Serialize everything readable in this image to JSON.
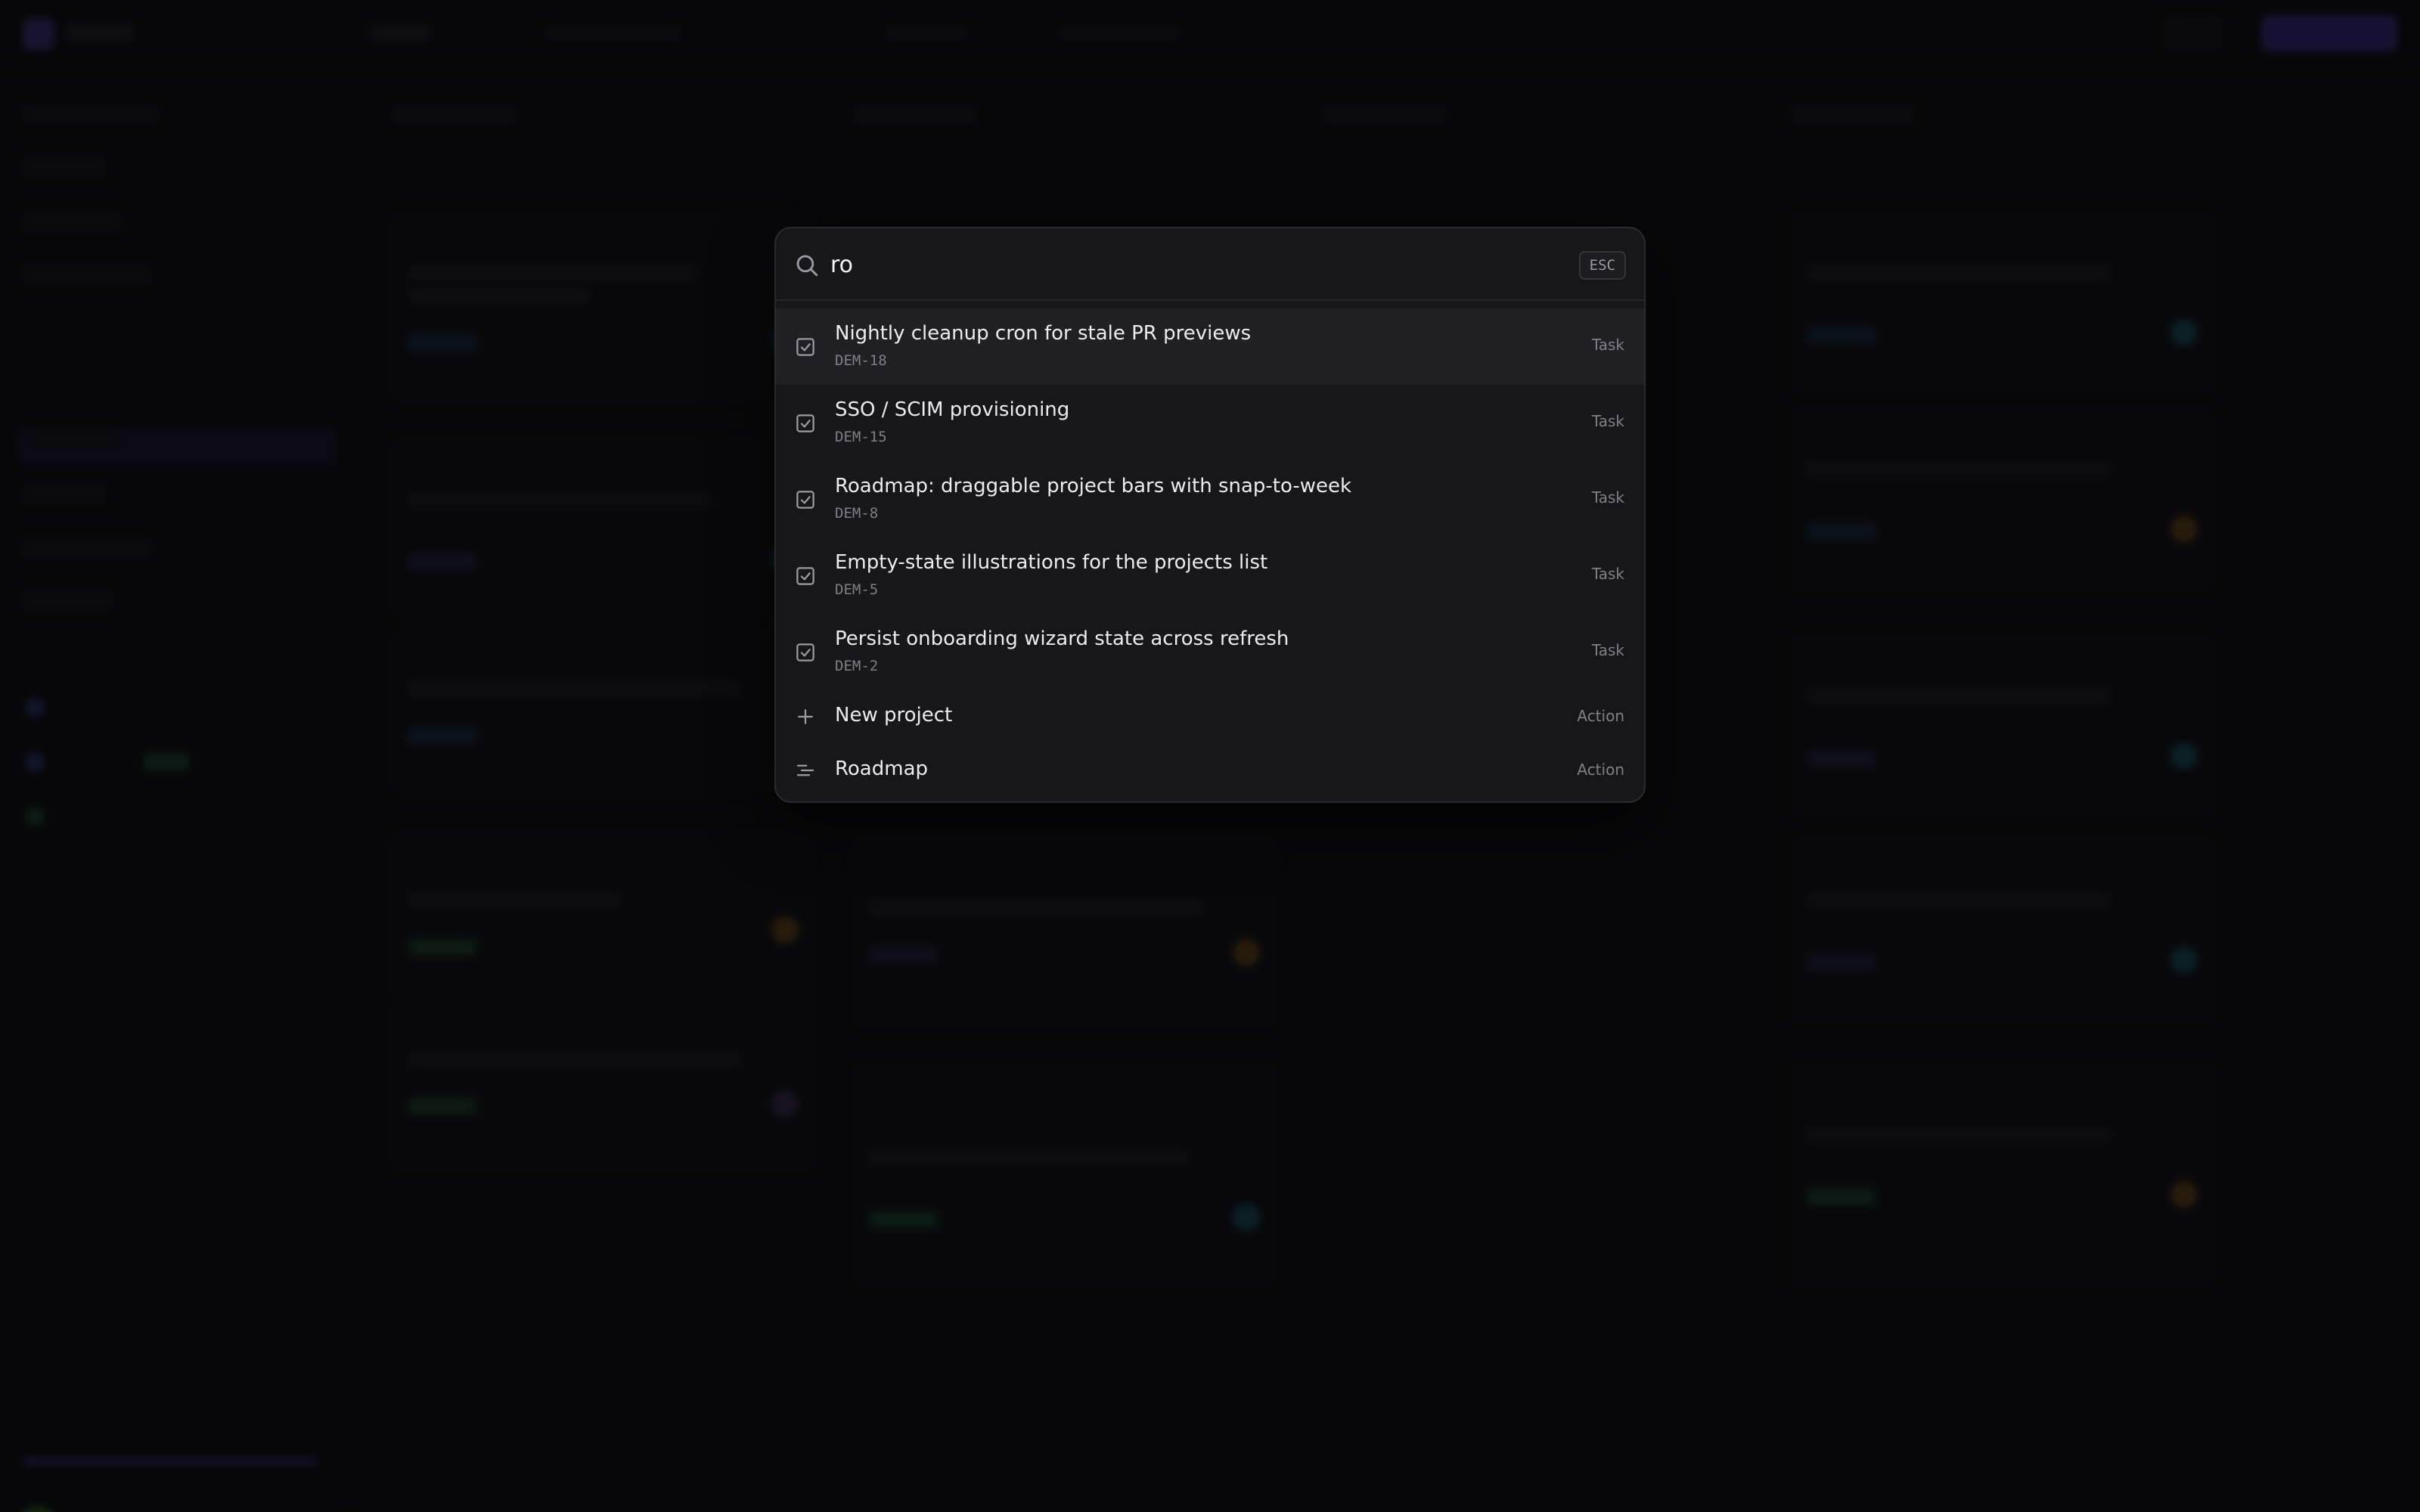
{
  "palette": {
    "query": "ro",
    "esc_label": "ESC",
    "results": [
      {
        "title": "Nightly cleanup cron for stale PR previews",
        "id": "DEM-18",
        "kind": "Task",
        "icon": "checkbox-icon",
        "selected": true
      },
      {
        "title": "SSO / SCIM provisioning",
        "id": "DEM-15",
        "kind": "Task",
        "icon": "checkbox-icon"
      },
      {
        "title": "Roadmap: draggable project bars with snap-to-week",
        "id": "DEM-8",
        "kind": "Task",
        "icon": "checkbox-icon"
      },
      {
        "title": "Empty-state illustrations for the projects list",
        "id": "DEM-5",
        "kind": "Task",
        "icon": "checkbox-icon"
      },
      {
        "title": "Persist onboarding wizard state across refresh",
        "id": "DEM-2",
        "kind": "Task",
        "icon": "checkbox-icon"
      }
    ],
    "actions": [
      {
        "title": "New project",
        "kind": "Action",
        "icon": "plus-icon"
      },
      {
        "title": "Roadmap",
        "kind": "Action",
        "icon": "roadmap-icon"
      }
    ]
  },
  "colors": {
    "accent": "#4a35b3",
    "palette_bg": "#17171a",
    "selected_row": "#202024"
  }
}
